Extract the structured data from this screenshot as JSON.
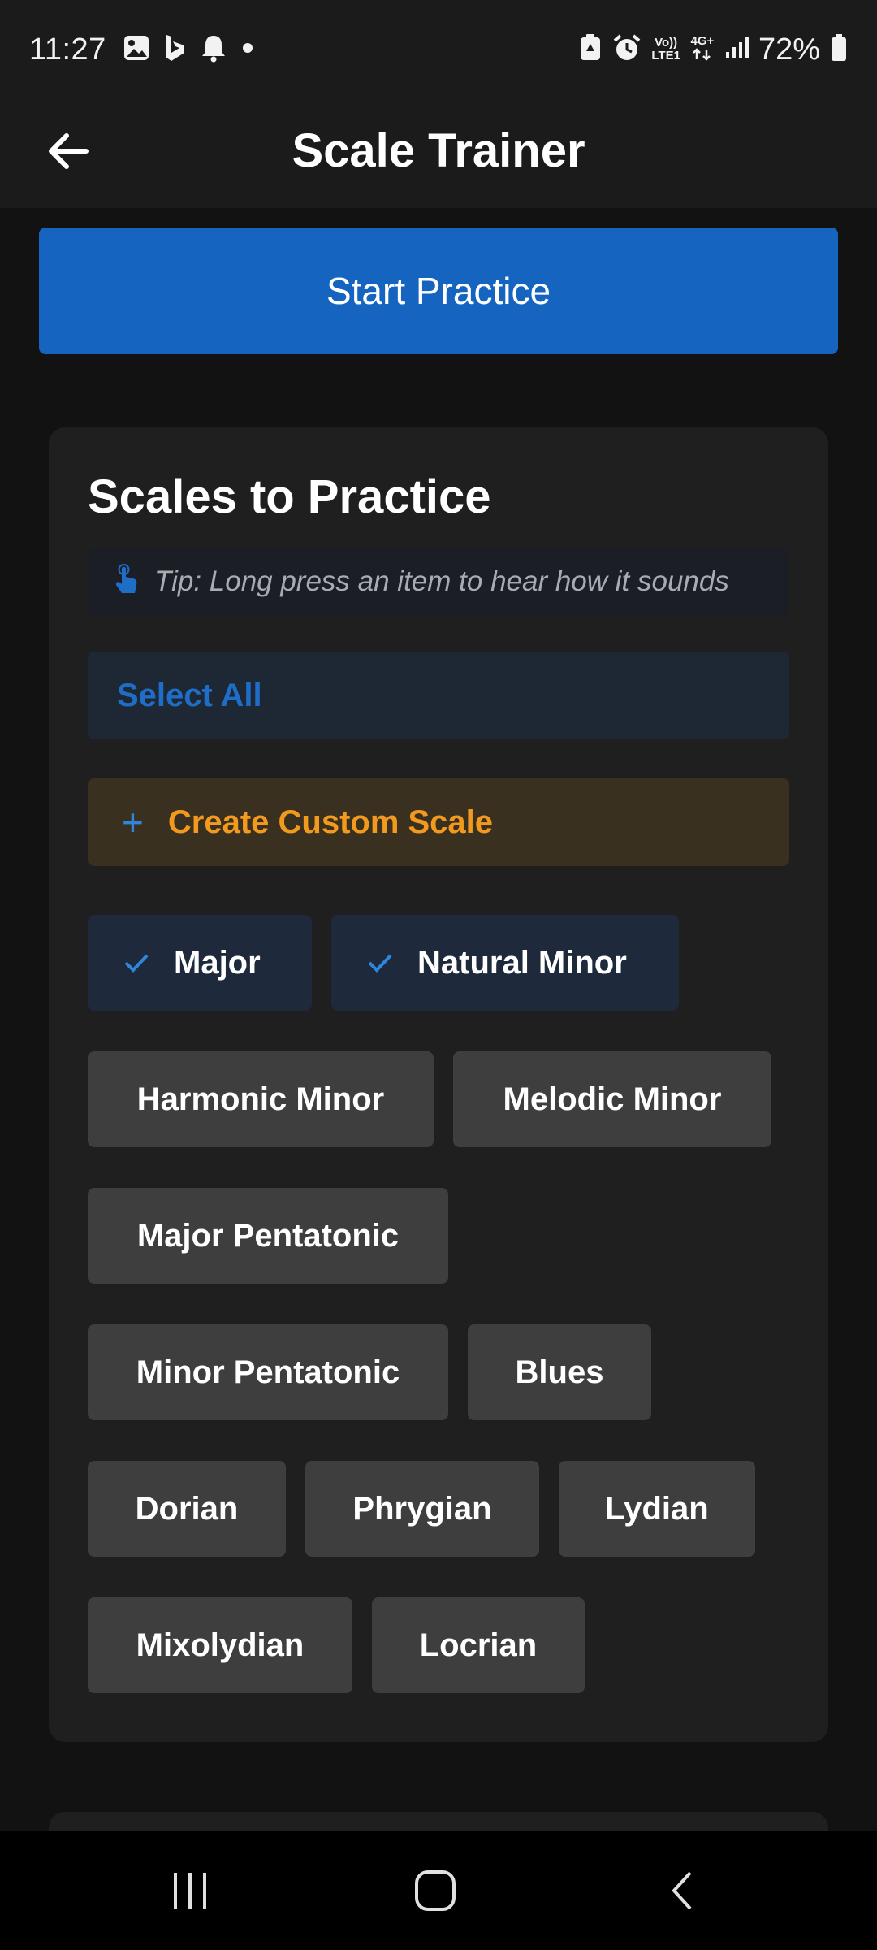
{
  "status_bar": {
    "time": "11:27",
    "battery": "72%",
    "volte_label_1": "Vo))",
    "volte_label_2": "LTE1",
    "net_label": "4G+"
  },
  "app_bar": {
    "title": "Scale Trainer",
    "back_icon": "arrow-back-icon"
  },
  "start_button": {
    "label": "Start Practice"
  },
  "scales_card": {
    "title": "Scales to Practice",
    "tip": "Tip: Long press an item to hear how it sounds",
    "select_all": "Select All",
    "create_custom": "Create Custom Scale",
    "scales": [
      {
        "label": "Major",
        "selected": true
      },
      {
        "label": "Natural Minor",
        "selected": true
      },
      {
        "label": "Harmonic Minor",
        "selected": false
      },
      {
        "label": "Melodic Minor",
        "selected": false
      },
      {
        "label": "Major Pentatonic",
        "selected": false
      },
      {
        "label": "Minor Pentatonic",
        "selected": false
      },
      {
        "label": "Blues",
        "selected": false
      },
      {
        "label": "Dorian",
        "selected": false
      },
      {
        "label": "Phrygian",
        "selected": false
      },
      {
        "label": "Lydian",
        "selected": false
      },
      {
        "label": "Mixolydian",
        "selected": false
      },
      {
        "label": "Locrian",
        "selected": false
      }
    ]
  },
  "colors": {
    "accent_blue": "#1565c0",
    "select_all_text": "#1e6ec8",
    "custom_scale_text": "#f29a1e",
    "chip_selected_bg": "#1e2a3c",
    "chip_bg": "#3e3e3e"
  }
}
